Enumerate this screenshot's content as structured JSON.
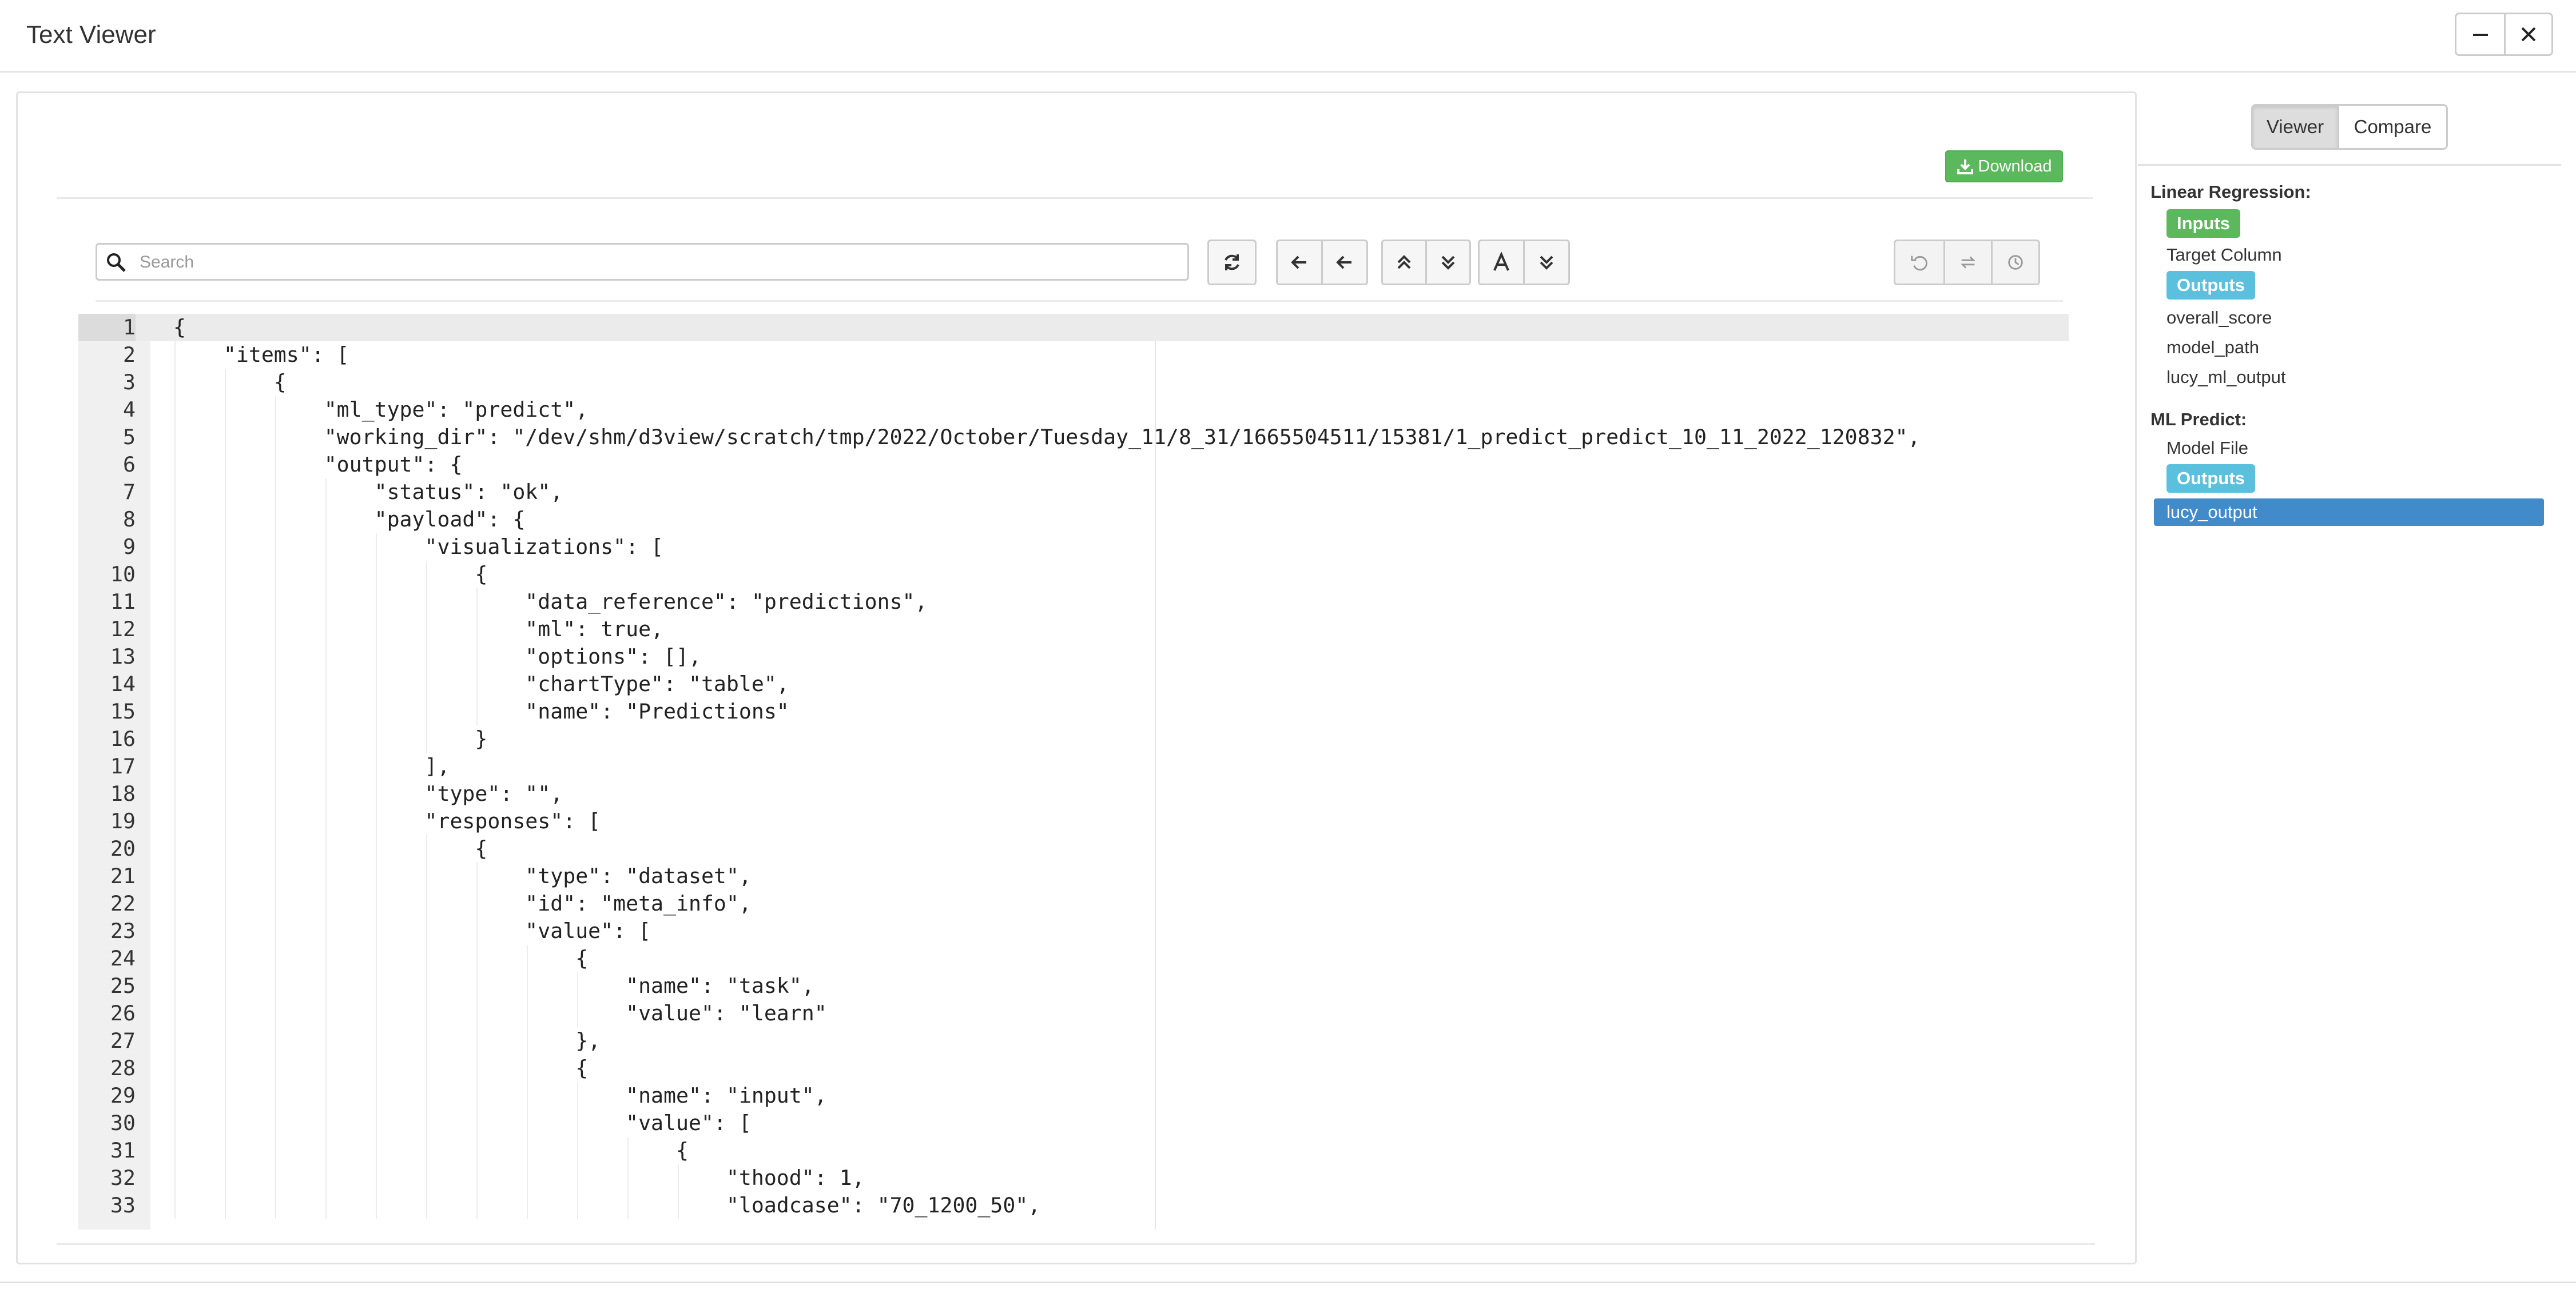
{
  "window": {
    "title": "Text Viewer",
    "minimize_icon": "minimize-icon",
    "close_icon": "close-icon"
  },
  "toolbar": {
    "download_label": "Download",
    "search_placeholder": "Search",
    "icons": [
      "refresh-icon",
      "arrow-left-icon",
      "arrow-left-icon",
      "chevrons-up-icon",
      "chevrons-down-icon",
      "font-icon",
      "chevrons-down-icon",
      "undo-icon",
      "repeat-icon",
      "history-icon"
    ]
  },
  "editor": {
    "lines": [
      "{",
      "    \"items\": [",
      "        {",
      "            \"ml_type\": \"predict\",",
      "            \"working_dir\": \"/dev/shm/d3view/scratch/tmp/2022/October/Tuesday_11/8_31/1665504511/15381/1_predict_predict_10_11_2022_120832\",",
      "            \"output\": {",
      "                \"status\": \"ok\",",
      "                \"payload\": {",
      "                    \"visualizations\": [",
      "                        {",
      "                            \"data_reference\": \"predictions\",",
      "                            \"ml\": true,",
      "                            \"options\": [],",
      "                            \"chartType\": \"table\",",
      "                            \"name\": \"Predictions\"",
      "                        }",
      "                    ],",
      "                    \"type\": \"\",",
      "                    \"responses\": [",
      "                        {",
      "                            \"type\": \"dataset\",",
      "                            \"id\": \"meta_info\",",
      "                            \"value\": [",
      "                                {",
      "                                    \"name\": \"task\",",
      "                                    \"value\": \"learn\"",
      "                                },",
      "                                {",
      "                                    \"name\": \"input\",",
      "                                    \"value\": [",
      "                                        {",
      "                                            \"thood\": 1,",
      "                                            \"loadcase\": \"70_1200_50\","
    ]
  },
  "sidebar": {
    "view_tabs": [
      "Viewer",
      "Compare"
    ],
    "sections": [
      {
        "heading": "Linear Regression:",
        "inputs_label": "Inputs",
        "inputs": [
          "Target Column"
        ],
        "outputs_label": "Outputs",
        "outputs": [
          "overall_score",
          "model_path",
          "lucy_ml_output"
        ]
      },
      {
        "heading": "ML Predict:",
        "inputs": [
          "Model File"
        ],
        "outputs_label": "Outputs",
        "outputs": [
          "lucy_output"
        ],
        "selected": "lucy_output"
      }
    ]
  },
  "colors": {
    "success": "#5cb85c",
    "info": "#5bc0de",
    "selected": "#428bca"
  }
}
